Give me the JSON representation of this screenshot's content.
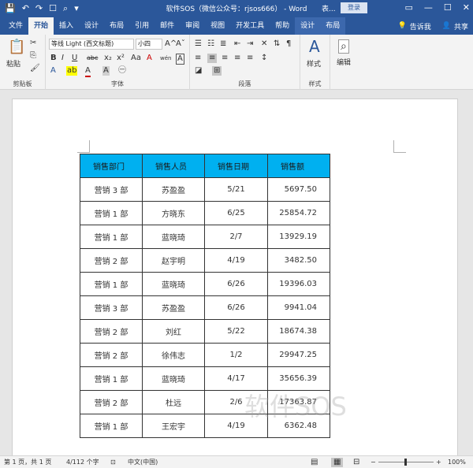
{
  "titlebar": {
    "title": "软件SOS（微信公众号：rjsos666） - Word",
    "context_label": "表...",
    "login_label": "登录",
    "qat": {
      "save_icon": "💾",
      "undo_icon": "↶",
      "redo_icon": "↷",
      "touch_icon": "☐",
      "print_preview_icon": "⌕",
      "customize_icon": "▾"
    },
    "window_controls": {
      "ribbon_display": "▭",
      "minimize": "—",
      "maximize": "☐",
      "close": "✕"
    }
  },
  "tabs": [
    {
      "label": "文件"
    },
    {
      "label": "开始"
    },
    {
      "label": "插入"
    },
    {
      "label": "设计"
    },
    {
      "label": "布局"
    },
    {
      "label": "引用"
    },
    {
      "label": "邮件"
    },
    {
      "label": "审阅"
    },
    {
      "label": "视图"
    },
    {
      "label": "开发工具"
    },
    {
      "label": "帮助"
    },
    {
      "label": "设计"
    },
    {
      "label": "布局"
    }
  ],
  "tellme": {
    "icon": "💡",
    "label": "告诉我"
  },
  "share": {
    "icon": "👤",
    "label": "共享"
  },
  "ribbon": {
    "clipboard": {
      "label": "剪贴板",
      "paste_label": "粘贴",
      "paste_icon": "📋",
      "cut_icon": "✂",
      "copy_icon": "⎘",
      "format_painter_icon": "🖌"
    },
    "font": {
      "label": "字体",
      "font_name": "等线 Light (西文标题)",
      "font_size": "小四",
      "bold": "B",
      "italic": "I",
      "underline": "U",
      "strike": "abc",
      "subscript": "x₂",
      "superscript": "x²",
      "grow": "A^",
      "shrink": "Aˇ",
      "case": "Aa",
      "clear": "A",
      "phonetic": "wén",
      "charborder": "A",
      "effects": "A",
      "highlight": "ab",
      "fontcolor": "A",
      "shading": "A",
      "enclose": "㊀"
    },
    "paragraph": {
      "label": "段落",
      "bullets": "☰",
      "numbering": "☷",
      "multilevel": "≣",
      "decrease_indent": "⇤",
      "increase_indent": "⇥",
      "chinese_layout": "✕",
      "sort": "⇅",
      "show_marks": "¶",
      "align_left": "≡",
      "align_center": "≡",
      "align_right": "≡",
      "justify": "≡",
      "distributed": "≡",
      "line_spacing": "↕",
      "shading": "◪",
      "borders": "⊞"
    },
    "styles": {
      "label": "样式",
      "button_label": "样式",
      "icon": "A"
    },
    "editing": {
      "label": "编辑",
      "button_label": "编辑",
      "icon": "⌕"
    }
  },
  "table": {
    "headers": [
      "销售部门",
      "销售人员",
      "销售日期",
      "销售额"
    ],
    "rows": [
      [
        "营销 3 部",
        "苏盈盈",
        "5/21",
        "5697.50"
      ],
      [
        "营销 1 部",
        "方晓东",
        "6/25",
        "25854.72"
      ],
      [
        "营销 1 部",
        "蓝晓琦",
        "2/7",
        "13929.19"
      ],
      [
        "营销 2 部",
        "赵宇明",
        "4/19",
        "3482.50"
      ],
      [
        "营销 1 部",
        "蓝晓琦",
        "6/26",
        "19396.03"
      ],
      [
        "营销 3 部",
        "苏盈盈",
        "6/26",
        "9941.04"
      ],
      [
        "营销 2 部",
        "刘红",
        "5/22",
        "18674.38"
      ],
      [
        "营销 2 部",
        "徐伟志",
        "1/2",
        "29947.25"
      ],
      [
        "营销 1 部",
        "蓝晓琦",
        "4/17",
        "35656.39"
      ],
      [
        "营销 2 部",
        "杜远",
        "2/6",
        "17363.87"
      ],
      [
        "营销 1 部",
        "王宏宇",
        "4/19",
        "6362.48"
      ]
    ],
    "header_color": "#00b0f0"
  },
  "watermark": "软件SOS",
  "statusbar": {
    "page": "第 1 页，共 1 页",
    "words": "4/112 个字",
    "proof_icon": "⊡",
    "language": "中文(中国)",
    "read_mode_icon": "▤",
    "print_layout_icon": "▦",
    "web_layout_icon": "⊟",
    "zoom_out": "−",
    "zoom_in": "+",
    "zoom": "100%"
  },
  "colors": {
    "accent": "#2b579a"
  }
}
